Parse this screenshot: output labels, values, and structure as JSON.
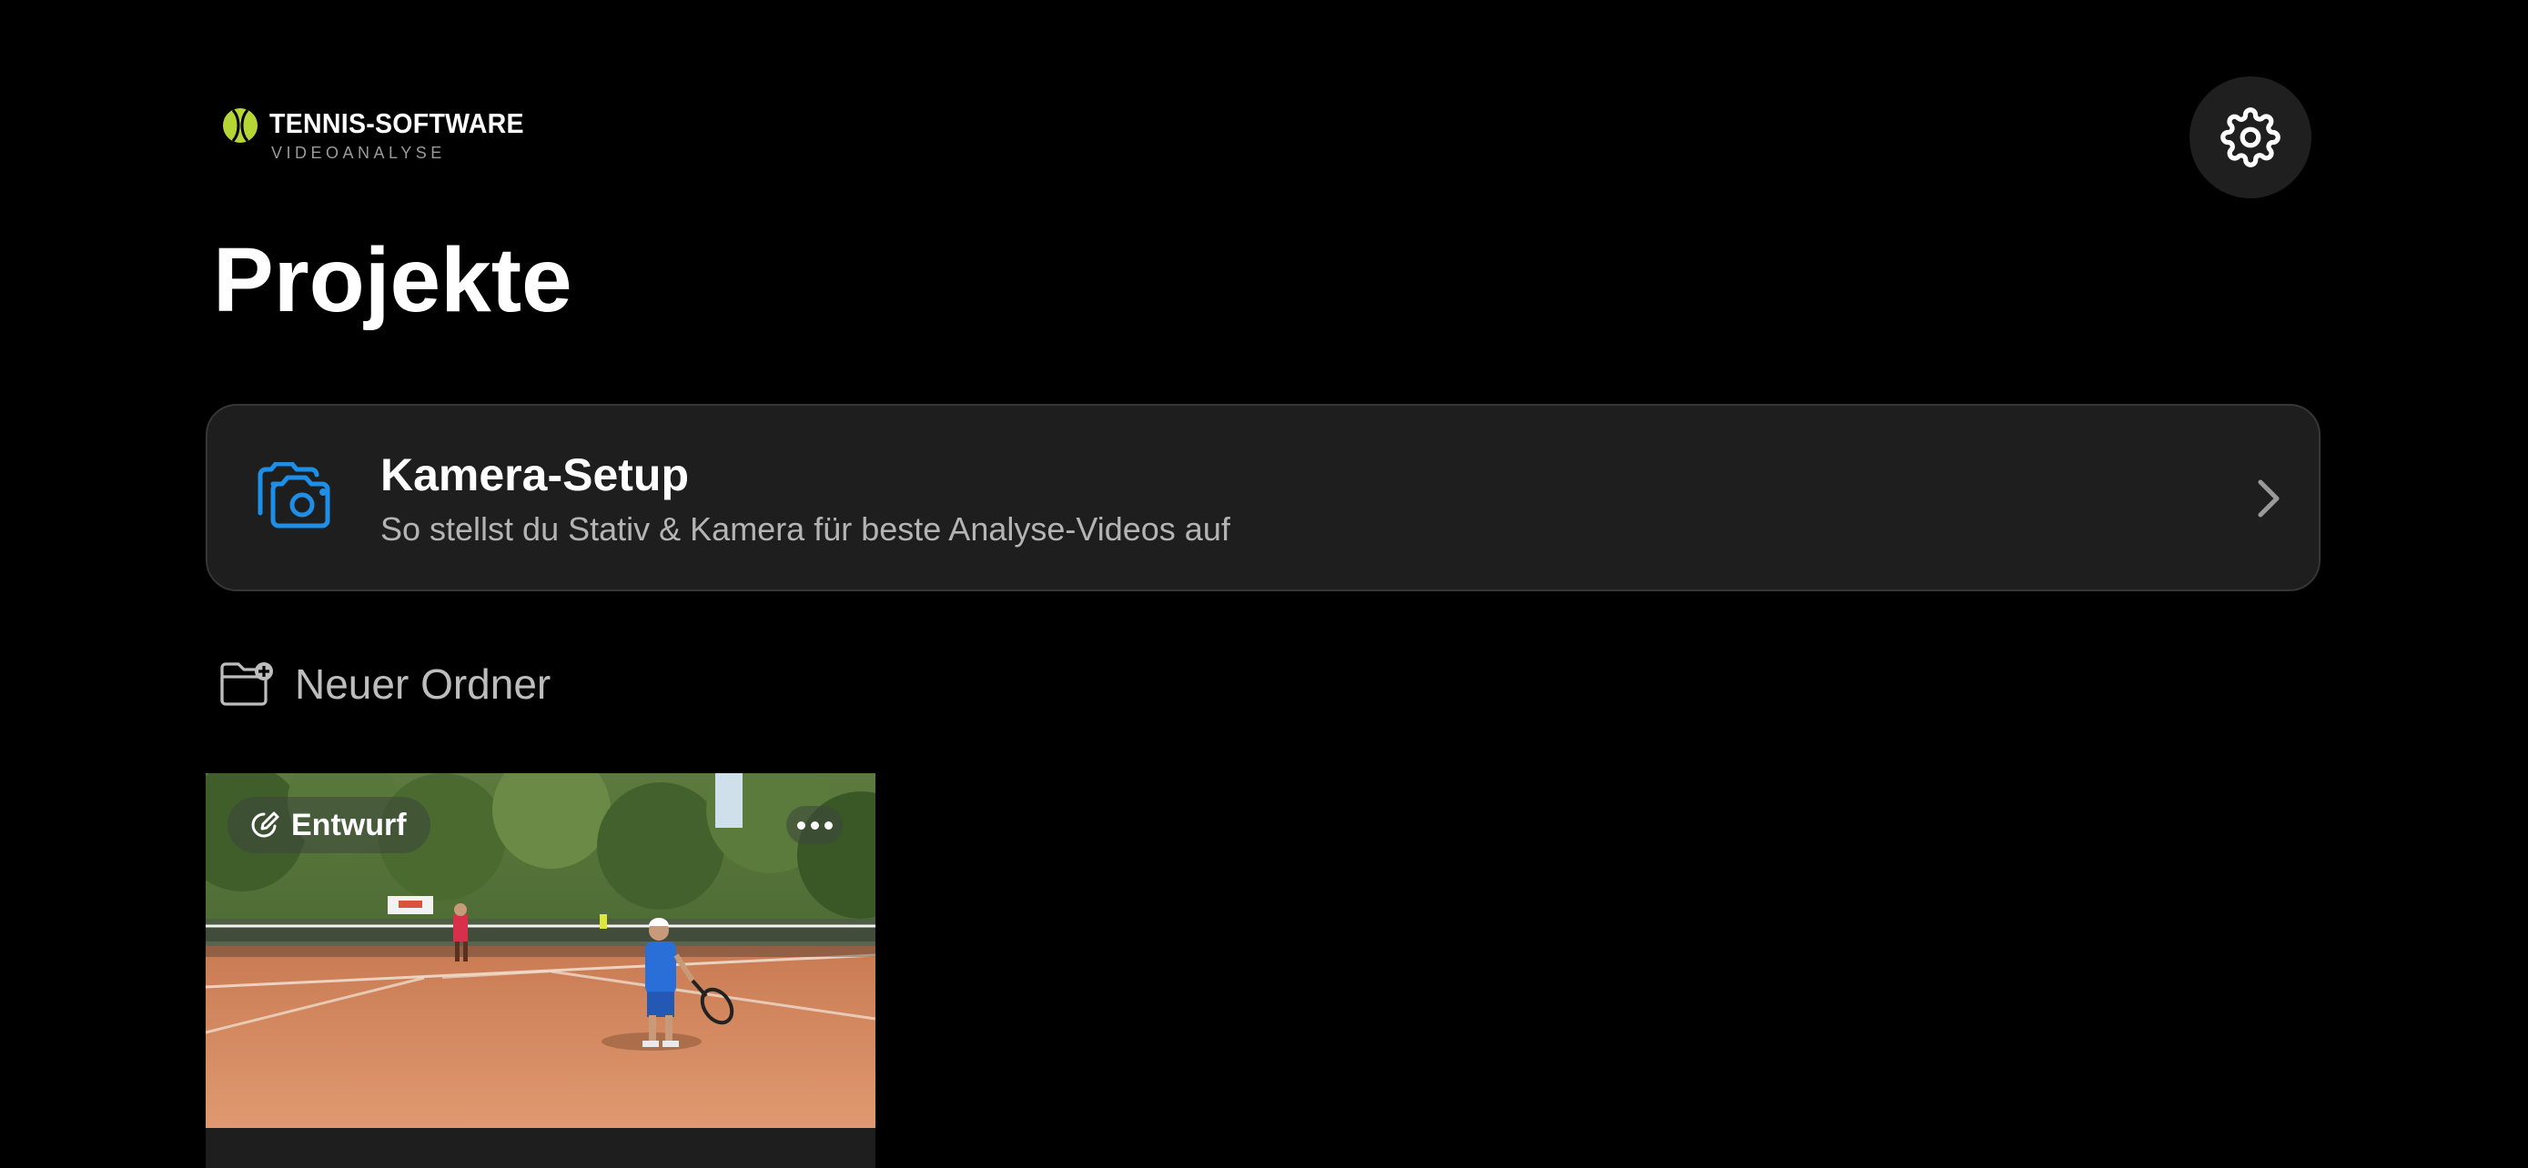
{
  "logo": {
    "title": "TENNIS-SOFTWARE",
    "subtitle": "VIDEOANALYSE",
    "accent_color": "#b6d636"
  },
  "header": {
    "settings_icon": "gear-icon"
  },
  "page": {
    "title": "Projekte"
  },
  "setup_card": {
    "icon": "camera-icon",
    "title": "Kamera-Setup",
    "subtitle": "So stellst du Stativ & Kamera für beste Analyse-Videos auf",
    "accent_color": "#1e8fe8"
  },
  "actions": {
    "new_folder_icon": "folder-plus-icon",
    "new_folder_label": "Neuer Ordner"
  },
  "projects": [
    {
      "status_icon": "edit-circle-icon",
      "status_label": "Entwurf",
      "menu_icon": "more-dots-icon",
      "thumbnail": "tennis-court-thumbnail"
    }
  ],
  "colors": {
    "background": "#000000",
    "card": "#1e1e1e",
    "card_border": "#363636",
    "secondary_text": "#b4b4b4"
  }
}
